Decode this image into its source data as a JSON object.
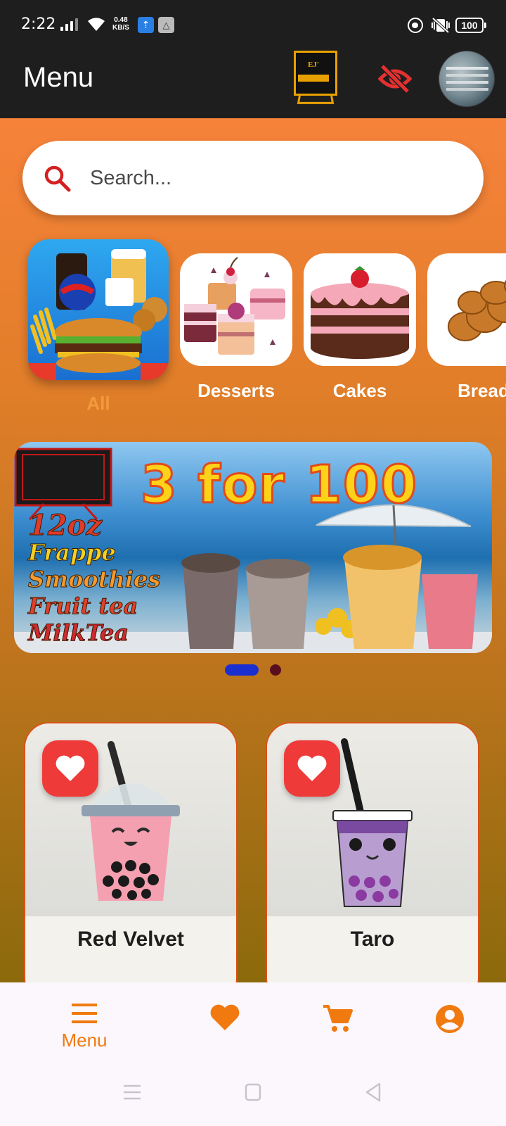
{
  "status_bar": {
    "time": "2:22",
    "net_speed_value": "0.48",
    "net_speed_unit": "KB/S",
    "battery": "100"
  },
  "app_bar": {
    "title": "Menu",
    "logo_text": "EJ'",
    "icons": [
      "visibility-off-icon",
      "avatar"
    ]
  },
  "search": {
    "placeholder": "Search..."
  },
  "categories": [
    {
      "label": "All",
      "selected": true
    },
    {
      "label": "Desserts",
      "selected": false
    },
    {
      "label": "Cakes",
      "selected": false
    },
    {
      "label": "Bread",
      "selected": false
    }
  ],
  "banner": {
    "headline": "3 for 100",
    "size": "12oz",
    "items": [
      "Frappe",
      "Smoothies",
      "Fruit tea",
      "MilkTea"
    ],
    "page_index": 0,
    "page_count": 2
  },
  "products": [
    {
      "name": "Red Velvet"
    },
    {
      "name": "Taro"
    }
  ],
  "bottom_nav": {
    "items": [
      {
        "label": "Menu",
        "icon": "menu-icon",
        "active": true
      },
      {
        "label": "",
        "icon": "heart-icon",
        "active": false
      },
      {
        "label": "",
        "icon": "cart-icon",
        "active": false
      },
      {
        "label": "",
        "icon": "account-icon",
        "active": false
      }
    ]
  },
  "colors": {
    "accent": "#f07a10",
    "favorite": "#ef3a3a",
    "dot_active": "#1a2fd0"
  }
}
